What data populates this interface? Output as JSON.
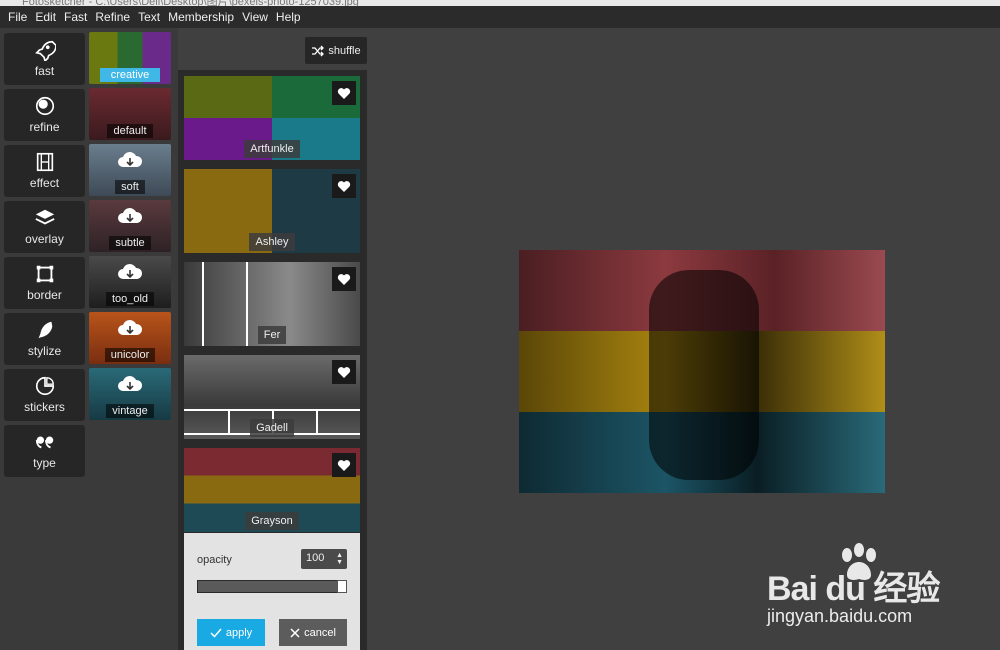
{
  "window": {
    "title": "Fotosketcher - C:\\Users\\Dell\\Desktop\\图片\\pexels-photo-1257039.jpg"
  },
  "menu": [
    "File",
    "Edit",
    "Fast",
    "Refine",
    "Text",
    "Membership",
    "View",
    "Help"
  ],
  "tools": [
    {
      "label": "fast",
      "icon": "rocket-icon"
    },
    {
      "label": "refine",
      "icon": "circles-icon"
    },
    {
      "label": "effect",
      "icon": "film-icon"
    },
    {
      "label": "overlay",
      "icon": "layers-icon"
    },
    {
      "label": "border",
      "icon": "square-frame-icon"
    },
    {
      "label": "stylize",
      "icon": "feather-icon"
    },
    {
      "label": "stickers",
      "icon": "sticker-icon"
    },
    {
      "label": "type",
      "icon": "quote-icon"
    }
  ],
  "categories": [
    {
      "label": "creative",
      "active": true
    },
    {
      "label": "default",
      "active": false
    },
    {
      "label": "soft",
      "download": true
    },
    {
      "label": "subtle",
      "download": true
    },
    {
      "label": "too_old",
      "download": true
    },
    {
      "label": "unicolor",
      "download": true
    },
    {
      "label": "vintage",
      "download": true
    }
  ],
  "shuffle": {
    "label": "shuffle"
  },
  "filters": [
    {
      "name": "Artfunkle"
    },
    {
      "name": "Ashley"
    },
    {
      "name": "Fer"
    },
    {
      "name": "Gadell"
    },
    {
      "name": "Grayson"
    }
  ],
  "settings": {
    "opacity_label": "opacity",
    "opacity_value": "100",
    "opacity_fraction": 1.0,
    "apply_label": "apply",
    "cancel_label": "cancel"
  },
  "watermark": {
    "brand": "Bai du 经验",
    "url": "jingyan.baidu.com"
  },
  "colors": {
    "accent": "#3fb8e8",
    "apply": "#19a9e3",
    "band_red": "#8c3a3f",
    "band_yellow": "#a8850f",
    "band_teal": "#1c5566"
  }
}
